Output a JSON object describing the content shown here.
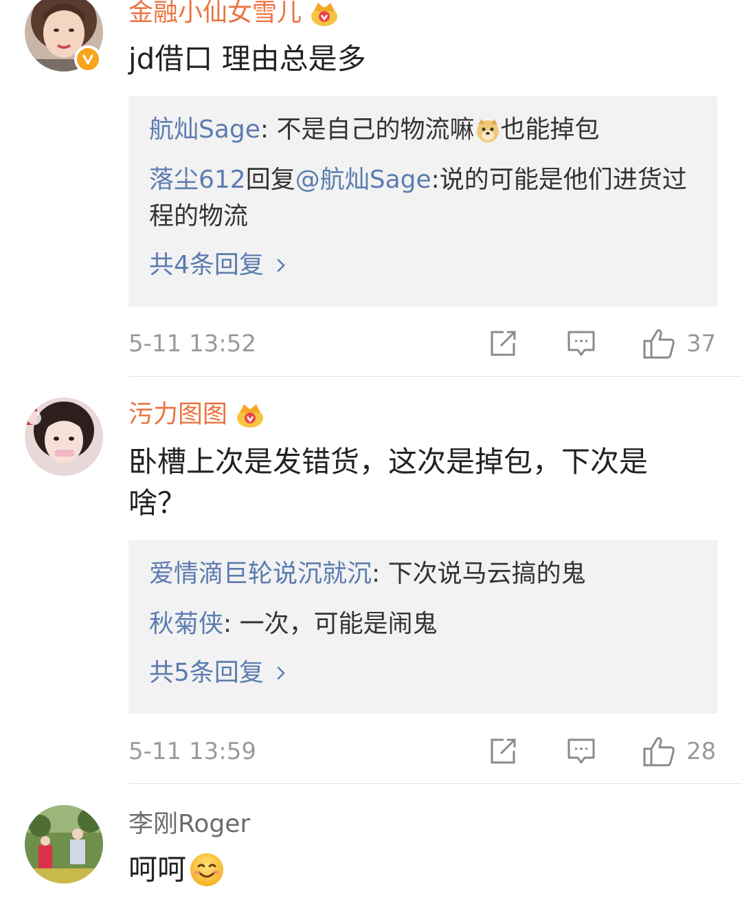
{
  "comments": [
    {
      "username": "金融小仙女雪儿",
      "content": "jd借口 理由总是多",
      "replies": [
        {
          "name": "航灿Sage",
          "sep": ": ",
          "text_before_emoji": "不是自己的物流嘛",
          "emoji": "doge-icon",
          "text_after_emoji": "也能掉包"
        },
        {
          "name": "落尘612",
          "reply_word": "回复",
          "mention": "@航灿Sage",
          "text": ":说的可能是他们进货过程的物流"
        }
      ],
      "more_replies": "共4条回复",
      "time": "5-11 13:52",
      "likes": "37"
    },
    {
      "username": "污力图图",
      "content": "卧槽上次是发错货，这次是掉包，下次是啥？",
      "replies": [
        {
          "name": "爱情滴巨轮说沉就沉",
          "sep": ": ",
          "text": "下次说马云搞的鬼"
        },
        {
          "name": "秋菊侠",
          "sep": ": ",
          "text": "一次，可能是闹鬼"
        }
      ],
      "more_replies": "共5条回复",
      "time": "5-11 13:59",
      "likes": "28"
    },
    {
      "username": "李刚Roger",
      "content": "呵呵",
      "emoji": "smile-icon"
    }
  ],
  "colors": {
    "username": "#eb7340",
    "reply_name": "#5b7cb0",
    "reply_bg": "#f2f2f2",
    "meta": "#9a9a9a",
    "verified": "#f7a51c"
  }
}
